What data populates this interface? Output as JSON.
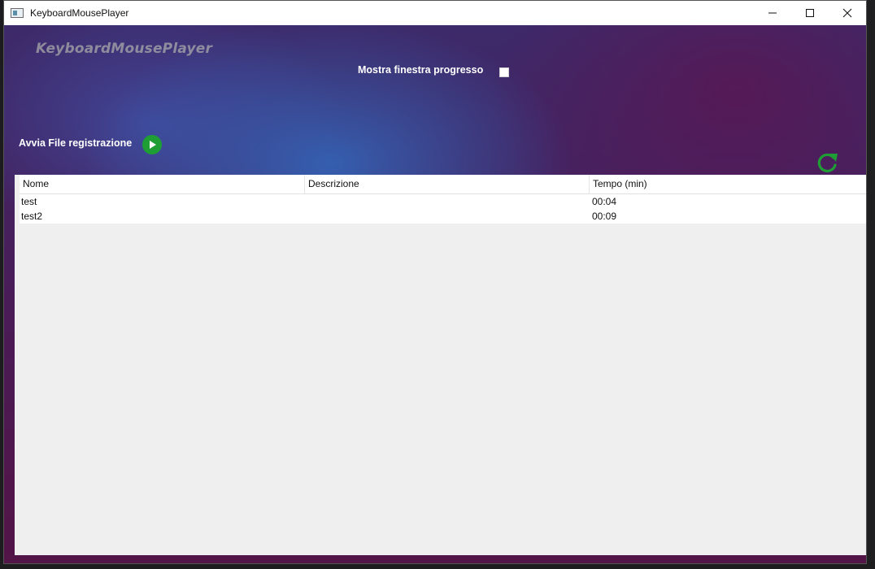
{
  "window": {
    "title": "KeyboardMousePlayer",
    "controls": {
      "minimize_icon": "minimize-icon",
      "maximize_icon": "maximize-icon",
      "close_icon": "close-icon"
    }
  },
  "header": {
    "app_name": "KeyboardMousePlayer",
    "show_progress_label": "Mostra finestra progresso",
    "show_progress_checked": false,
    "start_label": "Avvia File registrazione",
    "play_icon": "play-icon",
    "refresh_icon": "refresh-icon"
  },
  "colors": {
    "play_green": "#1e9e35",
    "refresh_green": "#1e9e35"
  },
  "list": {
    "columns": [
      "Nome",
      "Descrizione",
      "Tempo (min)"
    ],
    "rows": [
      {
        "nome": "test",
        "descrizione": "",
        "tempo": "00:04"
      },
      {
        "nome": "test2",
        "descrizione": "",
        "tempo": "00:09"
      }
    ]
  }
}
